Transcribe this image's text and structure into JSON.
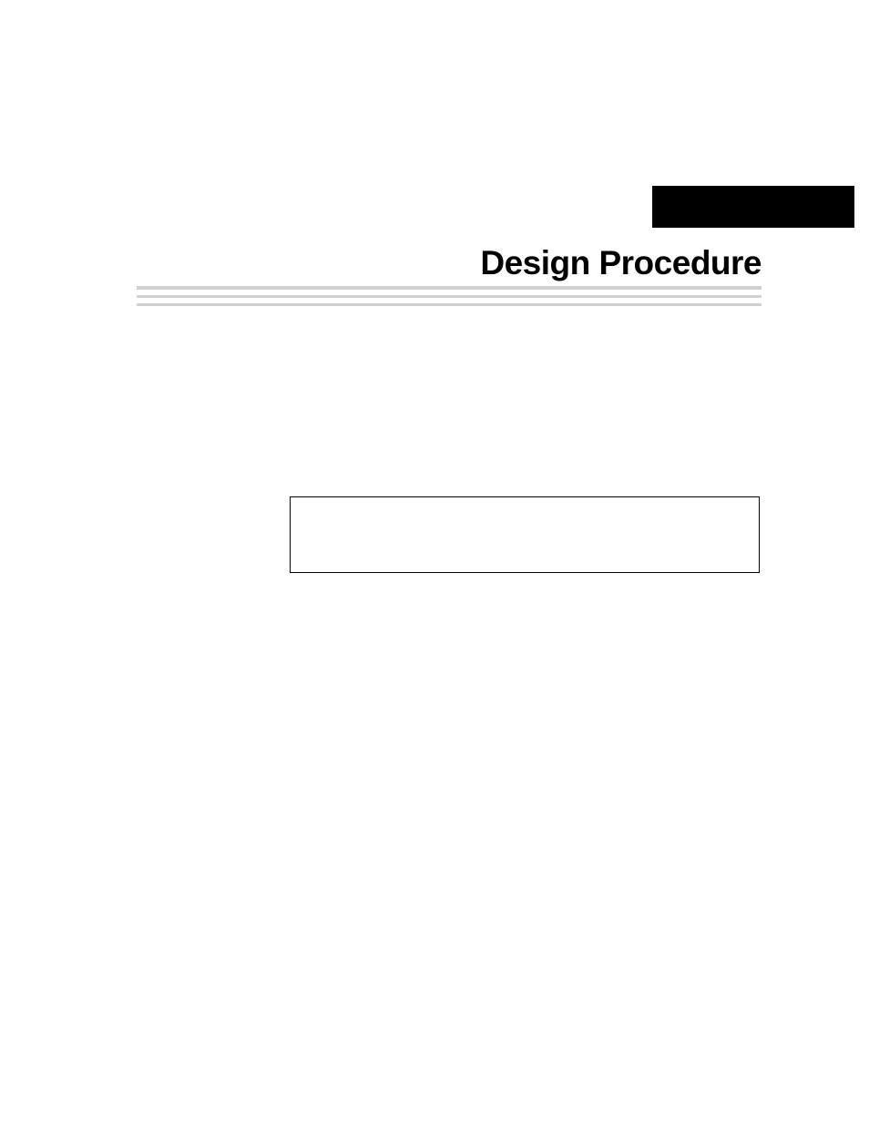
{
  "header": {
    "title": "Design Procedure"
  }
}
